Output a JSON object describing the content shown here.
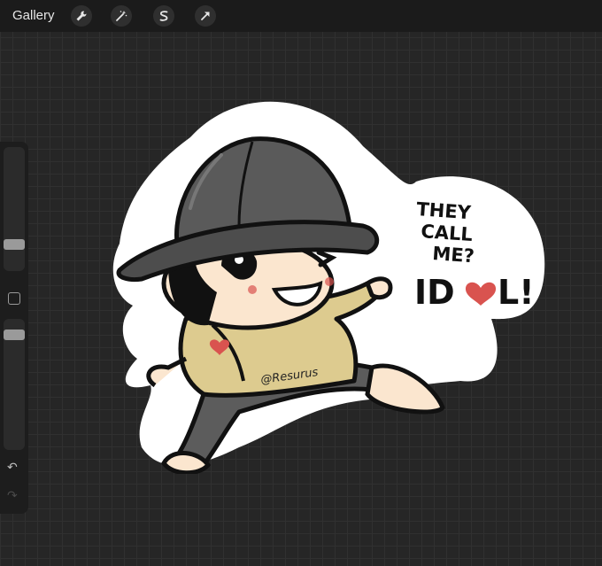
{
  "topbar": {
    "gallery_label": "Gallery",
    "tools": [
      "wrench-icon",
      "magic-wand-icon",
      "selection-icon",
      "transform-icon"
    ]
  },
  "sidebar": {
    "brush_size_level": 0.3,
    "opacity_level": 0.1,
    "undo_icon": "↶",
    "redo_icon": "↷"
  },
  "artwork": {
    "bubble_line1": "THEY",
    "bubble_line2": "CALL",
    "bubble_line3": "ME?",
    "bubble_big_prefix": "ID",
    "bubble_big_suffix": "L!",
    "watermark": "@Resurus",
    "colors": {
      "hat": "#5a5a5a",
      "shirt": "#ddcb8f",
      "pants": "#5c5c5c",
      "skin": "#fbe6cf",
      "heart": "#d9534f"
    }
  }
}
